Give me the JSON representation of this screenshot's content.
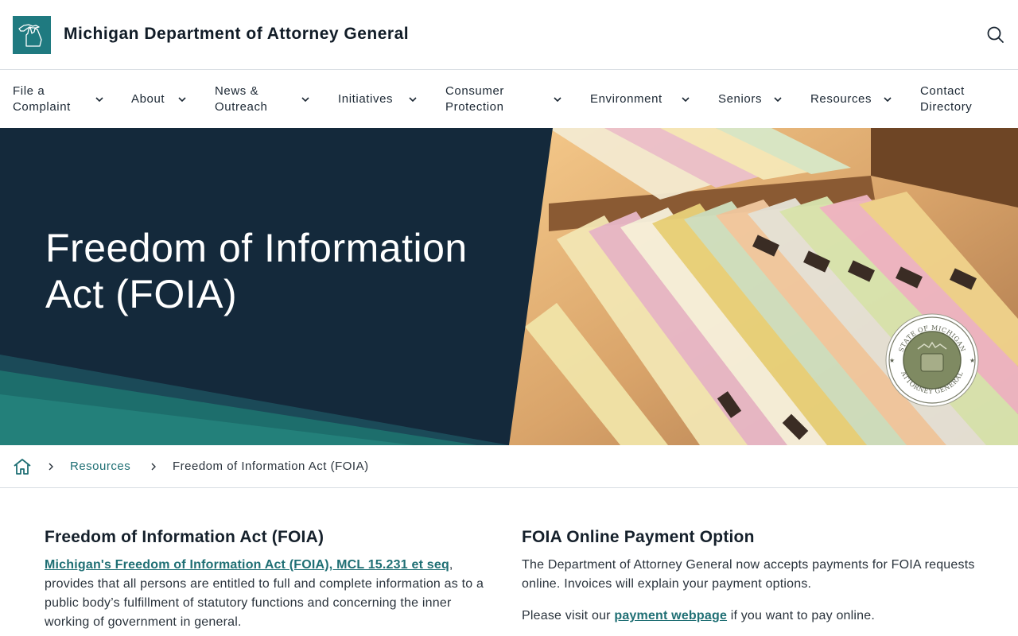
{
  "header": {
    "site_title": "Michigan Department of Attorney General",
    "logo_icon": "michigan-state-outline-icon",
    "search_icon": "search-icon",
    "brand_color": "#1f7a80"
  },
  "nav": {
    "items": [
      {
        "label": "File a Complaint",
        "has_dropdown": true
      },
      {
        "label": "About",
        "has_dropdown": true
      },
      {
        "label": "News & Outreach",
        "has_dropdown": true
      },
      {
        "label": "Initiatives",
        "has_dropdown": true
      },
      {
        "label": "Consumer Protection",
        "has_dropdown": true
      },
      {
        "label": "Environment",
        "has_dropdown": true
      },
      {
        "label": "Seniors",
        "has_dropdown": true
      },
      {
        "label": "Resources",
        "has_dropdown": true
      },
      {
        "label": "Contact Directory",
        "has_dropdown": false
      }
    ]
  },
  "hero": {
    "title": "Freedom of Information Act (FOIA)",
    "seal_top_text": "STATE OF MICHIGAN",
    "seal_bottom_text": "ATTORNEY GENERAL",
    "background_color": "#14293b",
    "accent_color": "#1d6e6c"
  },
  "breadcrumb": {
    "home_icon": "home-icon",
    "items": [
      {
        "label": "Resources"
      },
      {
        "label": "Freedom of Information Act (FOIA)"
      }
    ]
  },
  "main": {
    "left": {
      "heading": "Freedom of Information Act (FOIA)",
      "link_text": "Michigan's Freedom of Information Act (FOIA), MCL 15.231 et seq",
      "body_text": ", provides that all persons are entitled to full and complete information as to a public body’s fulfillment of statutory functions and concerning the inner working of government in general."
    },
    "right": {
      "heading": "FOIA Online Payment Option",
      "paragraph1": "The Department of Attorney General now accepts payments for FOIA requests online. Invoices will explain your payment options.",
      "paragraph2_prefix": "Please visit our ",
      "paragraph2_link": "payment webpage",
      "paragraph2_suffix": " if you want to pay online."
    }
  }
}
